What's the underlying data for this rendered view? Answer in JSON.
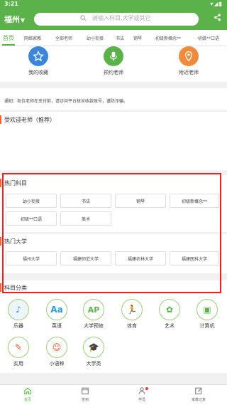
{
  "status": {
    "time": "3:21",
    "system": "▾◢▮"
  },
  "header": {
    "city": "福州",
    "search_placeholder": "请输入科目,大学或其它"
  },
  "tabs": [
    "首页",
    "网络家教",
    "全部老师",
    "幼小衔接",
    "书法",
    "钢琴",
    "初级新概念**",
    "初级**口语"
  ],
  "quick": [
    {
      "label": "我的收藏",
      "color": "#3b86d8"
    },
    {
      "label": "预约老师",
      "color": "#5bb24a"
    },
    {
      "label": "附近老师",
      "color": "#f08a3c"
    }
  ],
  "notice": "通知：各位老师在支付前，请访问平台核对收款账号，谨防诈骗。",
  "recommend_title": "受欢迎老师（推荐）",
  "hot_subjects": {
    "title": "热门科目",
    "items": [
      "幼小衔接",
      "书法",
      "钢琴",
      "初级新概念**",
      "初级**口语",
      "美术"
    ]
  },
  "hot_universities": {
    "title": "热门大学",
    "items": [
      "福州大学",
      "福建师范大学",
      "福建农林大学",
      "福建医科大学"
    ]
  },
  "categories": {
    "title": "科目分类",
    "items": [
      {
        "label": "乐器",
        "glyph": "♪",
        "color": "#2b9bd6"
      },
      {
        "label": "英语",
        "glyph": "Aa",
        "color": "#2b9bd6"
      },
      {
        "label": "大学预修",
        "glyph": "AP",
        "color": "#5bb24a"
      },
      {
        "label": "体育",
        "glyph": "🏃",
        "color": "#f08a3c"
      },
      {
        "label": "艺术",
        "glyph": "✿",
        "color": "#5bb24a"
      },
      {
        "label": "计算机",
        "glyph": "▣",
        "color": "#5bb24a"
      },
      {
        "label": "实用",
        "glyph": "✎",
        "color": "#e05a2a"
      },
      {
        "label": "小语种",
        "glyph": "☺",
        "color": "#e05a2a"
      },
      {
        "label": "大学类",
        "glyph": "🎓",
        "color": "#2b9bd6"
      }
    ]
  },
  "bottom_nav": [
    "首页",
    "签到",
    "学员",
    "家教过复"
  ]
}
